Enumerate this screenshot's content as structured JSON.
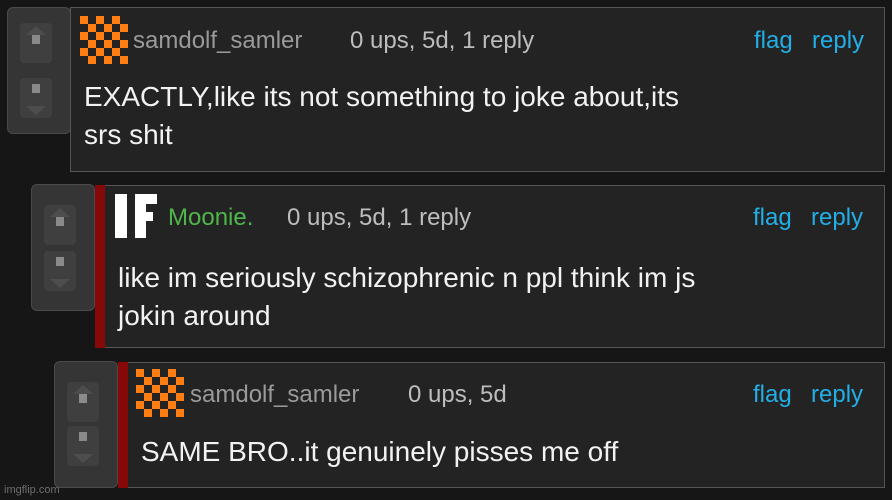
{
  "comments": [
    {
      "username": "samdolf_samler",
      "meta": "0 ups, 5d, 1 reply",
      "flag_label": "flag",
      "reply_label": "reply",
      "body_lines": [
        "EXACTLY,like its not something to joke about,its",
        "srs shit"
      ]
    },
    {
      "username": "Moonie.",
      "meta": "0 ups, 5d, 1 reply",
      "flag_label": "flag",
      "reply_label": "reply",
      "body_lines": [
        "like im seriously schizophrenic n ppl think im js",
        "jokin around"
      ]
    },
    {
      "username": "samdolf_samler",
      "meta": "0 ups, 5d",
      "flag_label": "flag",
      "reply_label": "reply",
      "body_lines": [
        "SAME BRO..it genuinely pisses me off"
      ]
    }
  ],
  "icons": {
    "upvote": "upvote-arrow-icon",
    "downvote": "downvote-arrow-icon",
    "avatar_checker": "checkerboard-avatar-icon",
    "avatar_moonie": "IF-letters-avatar-icon"
  },
  "colors": {
    "background": "#161616",
    "comment_bg": "#232323",
    "link": "#22aee6",
    "username_green": "#4fb64a",
    "reply_bar": "#860808",
    "avatar_orange": "#ff7f14"
  },
  "watermark": "imgflip.com"
}
